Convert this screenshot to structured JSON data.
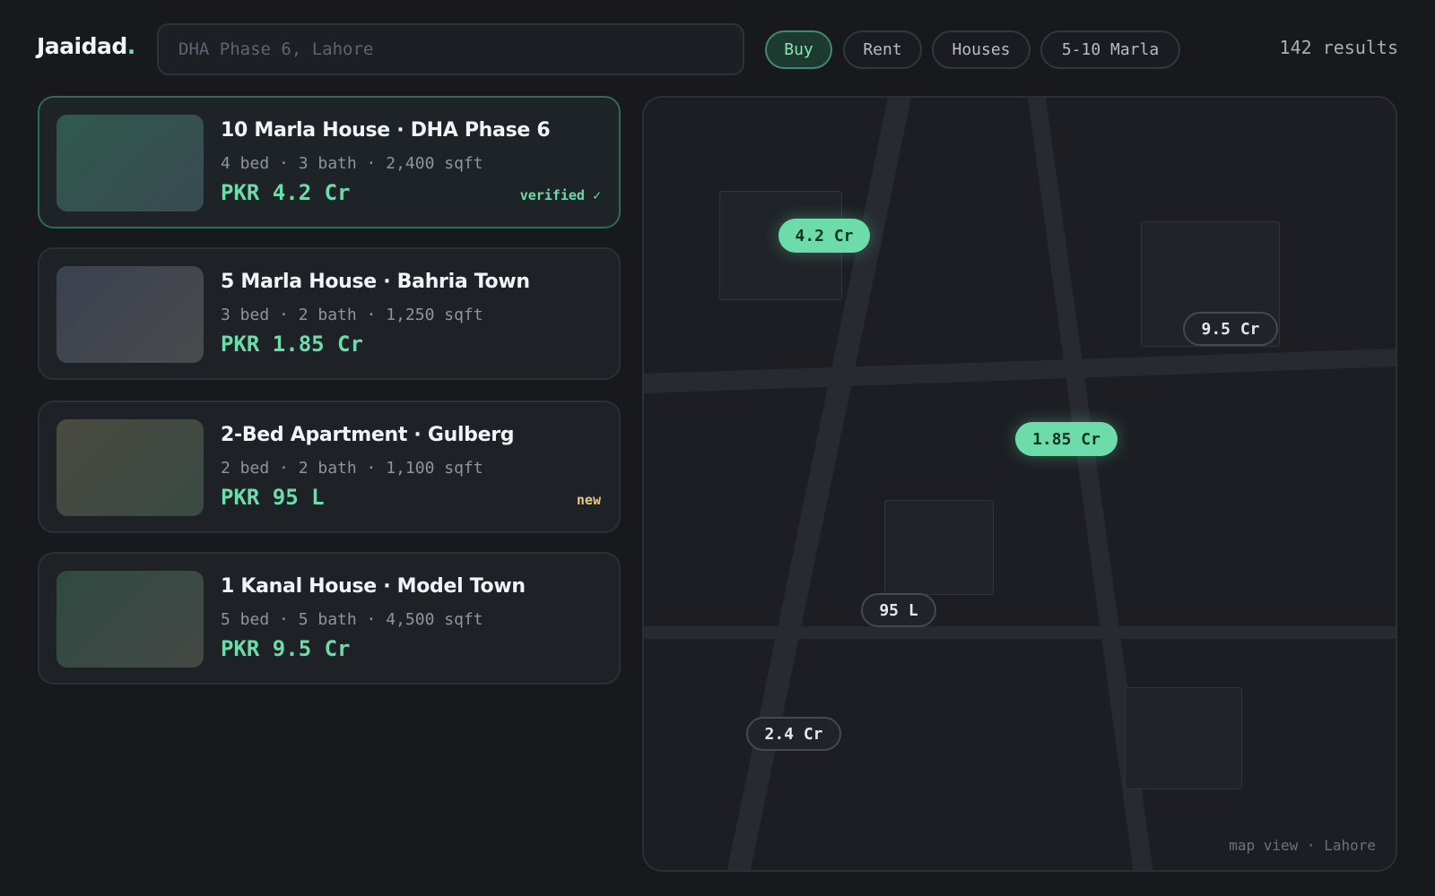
{
  "brand": {
    "name": "Jaaidad",
    "dot": "."
  },
  "search": {
    "placeholder": "DHA Phase 6, Lahore",
    "value": ""
  },
  "filters": [
    {
      "label": "Buy",
      "active": true
    },
    {
      "label": "Rent",
      "active": false
    },
    {
      "label": "Houses",
      "active": false
    },
    {
      "label": "5-10 Marla",
      "active": false
    }
  ],
  "results_label": "142 results",
  "listings": [
    {
      "title": "10 Marla House · DHA Phase 6",
      "meta": "4 bed · 3 bath · 2,400 sqft",
      "price": "PKR 4.2 Cr",
      "badge": "verified ✓",
      "badge_type": "verified",
      "selected": true,
      "thumb_colors": [
        "#2f5a4c",
        "#3a4a52"
      ]
    },
    {
      "title": "5 Marla House · Bahria Town",
      "meta": "3 bed · 2 bath · 1,250 sqft",
      "price": "PKR 1.85 Cr",
      "badge": "",
      "badge_type": "",
      "selected": false,
      "thumb_colors": [
        "#3a4250",
        "#4a4a4c"
      ]
    },
    {
      "title": "2-Bed Apartment · Gulberg",
      "meta": "2 bed · 2 bath · 1,100 sqft",
      "price": "PKR 95 L",
      "badge": "new",
      "badge_type": "new",
      "selected": false,
      "thumb_colors": [
        "#4a4a40",
        "#3a4a44"
      ]
    },
    {
      "title": "1 Kanal House · Model Town",
      "meta": "5 bed · 5 bath · 4,500 sqft",
      "price": "PKR 9.5 Cr",
      "badge": "",
      "badge_type": "",
      "selected": false,
      "thumb_colors": [
        "#2f4a42",
        "#454845"
      ]
    }
  ],
  "map": {
    "caption": "map view · Lahore",
    "pins": [
      {
        "label": "4.2 Cr",
        "highlight": true
      },
      {
        "label": "9.5 Cr",
        "highlight": false
      },
      {
        "label": "1.85 Cr",
        "highlight": true
      },
      {
        "label": "95 L",
        "highlight": false
      },
      {
        "label": "2.4 Cr",
        "highlight": false
      }
    ]
  },
  "colors": {
    "accent": "#6ddcaa",
    "background": "#17191d",
    "badge_new": "#e4c98a"
  }
}
